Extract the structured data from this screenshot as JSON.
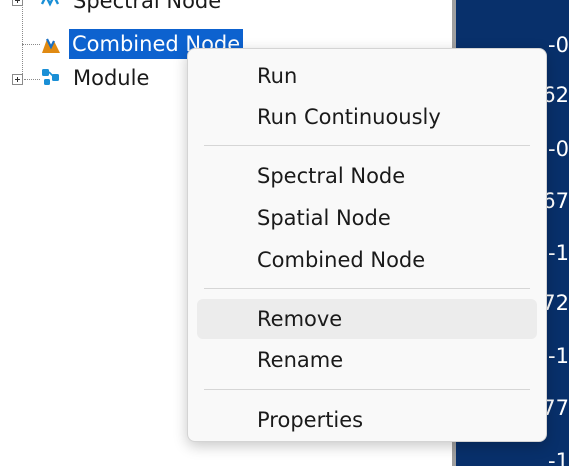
{
  "tree": {
    "items": [
      {
        "label": "Spectral Node",
        "icon": "spectral-node-icon",
        "selected": false
      },
      {
        "label": "Combined Node",
        "icon": "combined-node-icon",
        "selected": true
      },
      {
        "label": "Module",
        "icon": "module-icon",
        "selected": false
      }
    ]
  },
  "right_panel": {
    "fragments": [
      "-0",
      "62",
      "-0",
      "67",
      "-1",
      "72",
      "-1",
      "77",
      "-1"
    ]
  },
  "context_menu": {
    "items": [
      {
        "label": "Run"
      },
      {
        "label": "Run Continuously"
      },
      {
        "label": "Spectral Node"
      },
      {
        "label": "Spatial Node"
      },
      {
        "label": "Combined Node"
      },
      {
        "label": "Remove",
        "hovered": true
      },
      {
        "label": "Rename"
      },
      {
        "label": "Properties"
      }
    ]
  },
  "colors": {
    "selection": "#0d62cf",
    "panel_dark": "#08306b",
    "menu_bg": "#f9f9f9",
    "menu_hover": "#ececec"
  }
}
